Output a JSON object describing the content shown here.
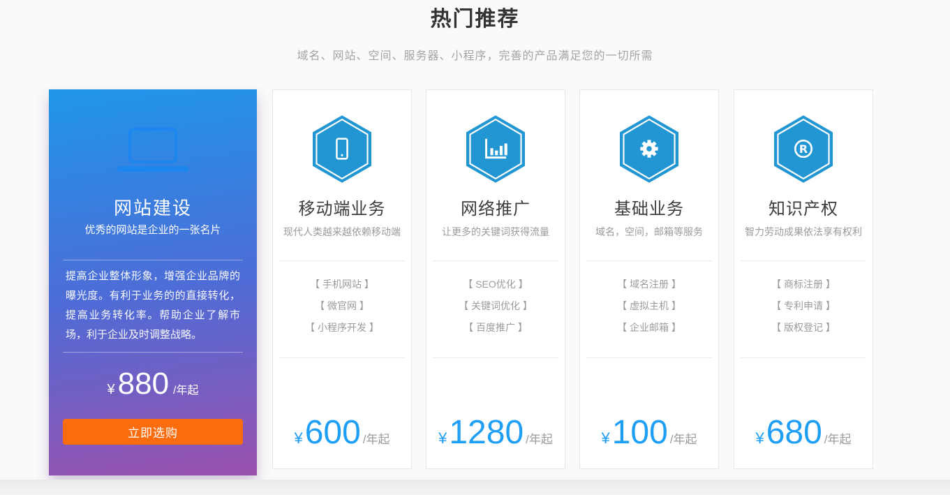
{
  "header": {
    "title": "热门推荐",
    "subtitle": "域名、网站、空间、服务器、小程序，完善的产品满足您的一切所需"
  },
  "featured_card": {
    "icon": "laptop-icon",
    "title": "网站建设",
    "subtitle": "优秀的网站是企业的一张名片",
    "description": "提高企业整体形象，增强企业品牌的曝光度。有利于业务的的直接转化，提高业务转化率。帮助企业了解市场，利于企业及时调整战略。",
    "currency": "¥",
    "price": "880",
    "price_unit": "/年起",
    "button_label": "立即选购"
  },
  "cards": [
    {
      "icon": "smartphone-icon",
      "title": "移动端业务",
      "subtitle": "现代人类越来越依赖移动端",
      "items": [
        "【 手机网站 】",
        "【 微官网 】",
        "【 小程序开发 】"
      ],
      "currency": "¥",
      "price": "600",
      "price_unit": "/年起"
    },
    {
      "icon": "bar-chart-icon",
      "title": "网络推广",
      "subtitle": "让更多的关键词获得流量",
      "items": [
        "【 SEO优化 】",
        "【 关键词优化 】",
        "【 百度推广 】"
      ],
      "currency": "¥",
      "price": "1280",
      "price_unit": "/年起"
    },
    {
      "icon": "gear-icon",
      "title": "基础业务",
      "subtitle": "域名，空间，邮箱等服务",
      "items": [
        "【 域名注册 】",
        "【 虚拟主机 】",
        "【 企业邮箱 】"
      ],
      "currency": "¥",
      "price": "100",
      "price_unit": "/年起"
    },
    {
      "icon": "registered-trademark-icon",
      "title": "知识产权",
      "subtitle": "智力劳动成果依法享有权利",
      "items": [
        "【 商标注册 】",
        "【 专利申请 】",
        "【 版权登记 】"
      ],
      "currency": "¥",
      "price": "680",
      "price_unit": "/年起"
    }
  ],
  "colors": {
    "hexagon_blue": "#2196d3",
    "price_blue": "#1e9ef4",
    "button_orange": "#fb6c0f",
    "featured_gradient_top": "#1f96e9",
    "featured_gradient_bottom": "#9b51ae",
    "title_dark": "#333333",
    "muted_gray": "#9b9b9b"
  }
}
